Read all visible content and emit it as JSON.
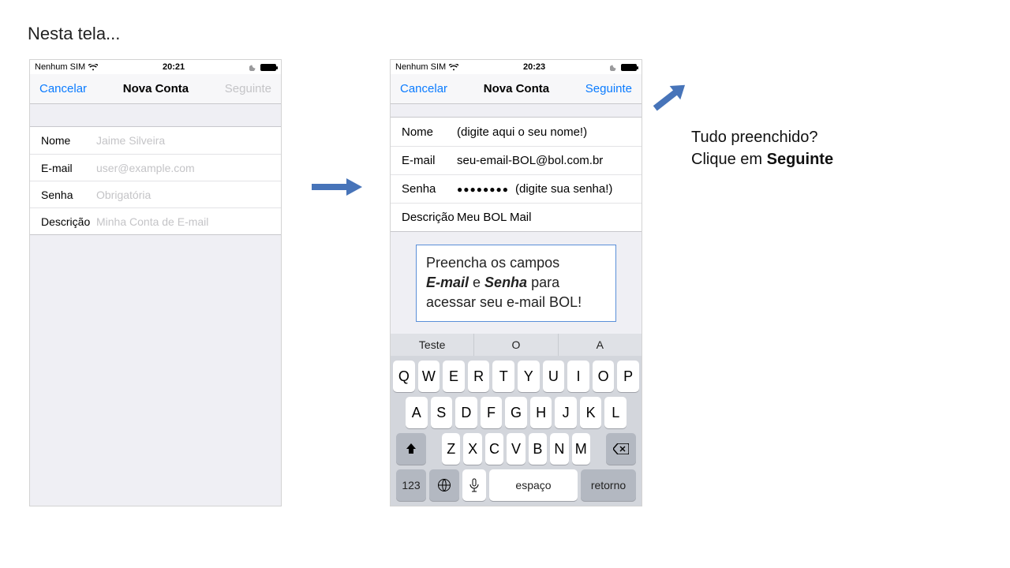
{
  "slide": {
    "title": "Nesta tela..."
  },
  "phoneA": {
    "status": {
      "carrier": "Nenhum SIM",
      "time": "20:21"
    },
    "nav": {
      "cancel": "Cancelar",
      "title": "Nova Conta",
      "next": "Seguinte"
    },
    "fields": {
      "name_label": "Nome",
      "name_value": "Jaime Silveira",
      "email_label": "E-mail",
      "email_value": "user@example.com",
      "pass_label": "Senha",
      "pass_value": "Obrigatória",
      "desc_label": "Descrição",
      "desc_value": "Minha Conta de E-mail"
    }
  },
  "phoneB": {
    "status": {
      "carrier": "Nenhum SIM",
      "time": "20:23"
    },
    "nav": {
      "cancel": "Cancelar",
      "title": "Nova Conta",
      "next": "Seguinte"
    },
    "fields": {
      "name_label": "Nome",
      "name_hint": "(digite aqui o seu nome!)",
      "email_label": "E-mail",
      "email_value": "seu-email-BOL@bol.com.br",
      "pass_label": "Senha",
      "pass_dots": "●●●●●●●●",
      "pass_hint": "(digite sua senha!)",
      "desc_label": "Descrição",
      "desc_value": "Meu BOL Mail"
    },
    "callout": {
      "l1a": "Preencha os campos",
      "em1": "E-mail",
      "mid": " e ",
      "em2": "Senha",
      "l2b": " para",
      "l3": "acessar seu e-mail BOL!"
    },
    "keyboard": {
      "suggest": [
        "Teste",
        "O",
        "A"
      ],
      "row1": [
        "Q",
        "W",
        "E",
        "R",
        "T",
        "Y",
        "U",
        "I",
        "O",
        "P"
      ],
      "row2": [
        "A",
        "S",
        "D",
        "F",
        "G",
        "H",
        "J",
        "K",
        "L"
      ],
      "row3": [
        "Z",
        "X",
        "C",
        "V",
        "B",
        "N",
        "M"
      ],
      "numlabel": "123",
      "space": "espaço",
      "return": "retorno"
    }
  },
  "annotation": {
    "line1": "Tudo preenchido?",
    "line2a": "Clique em ",
    "line2b": "Seguinte"
  }
}
